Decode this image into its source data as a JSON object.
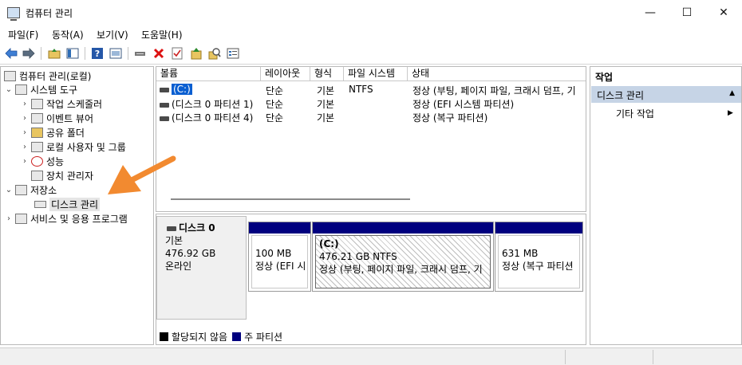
{
  "window": {
    "title": "컴퓨터 관리",
    "minimize_glyph": "—",
    "maximize_glyph": "☐",
    "close_glyph": "✕"
  },
  "menu": [
    "파일(F)",
    "동작(A)",
    "보기(V)",
    "도움말(H)"
  ],
  "toolbar": {
    "icons": [
      "back-icon",
      "forward-icon",
      "up-folder-icon",
      "show-hide-tree-icon",
      "help-icon",
      "view-icon",
      "connect-icon",
      "delete-icon",
      "check-icon",
      "open-icon",
      "search-icon",
      "properties-icon"
    ]
  },
  "tree": {
    "root": "컴퓨터 관리(로컬)",
    "system_tools": "시스템 도구",
    "task_scheduler": "작업 스케줄러",
    "event_viewer": "이벤트 뷰어",
    "shared_folders": "공유 폴더",
    "local_users_groups": "로컬 사용자 및 그룹",
    "performance": "성능",
    "device_manager": "장치 관리자",
    "storage": "저장소",
    "disk_management": "디스크 관리",
    "services_apps": "서비스 및 응용 프로그램"
  },
  "volume_table": {
    "headers": [
      "볼륨",
      "레이아웃",
      "형식",
      "파일 시스템",
      "상태"
    ],
    "rows": [
      [
        "(C:)",
        "단순",
        "기본",
        "NTFS",
        "정상 (부팅, 페이지 파일, 크래시 덤프, 기"
      ],
      [
        "(디스크 0 파티션 1)",
        "단순",
        "기본",
        "",
        "정상 (EFI 시스템 파티션)"
      ],
      [
        "(디스크 0 파티션 4)",
        "단순",
        "기본",
        "",
        "정상 (복구 파티션)"
      ]
    ]
  },
  "disk": {
    "name": "디스크 0",
    "type": "기본",
    "size": "476.92 GB",
    "status": "온라인",
    "partitions": [
      {
        "label": "",
        "line1": "100 MB",
        "line2": "정상 (EFI 시"
      },
      {
        "label": "(C:)",
        "line1": "476.21 GB NTFS",
        "line2": "정상 (부팅, 페이지 파일, 크래시 덤프, 기"
      },
      {
        "label": "",
        "line1": "631 MB",
        "line2": "정상 (복구 파티션"
      }
    ]
  },
  "legend": {
    "unallocated": "할당되지 않음",
    "primary": "주 파티션",
    "unallocated_color": "#000000",
    "primary_color": "#00007f"
  },
  "actions": {
    "header": "작업",
    "section": "디스크 관리",
    "more": "기타 작업",
    "collapse_glyph": "▲",
    "more_glyph": "▶"
  }
}
